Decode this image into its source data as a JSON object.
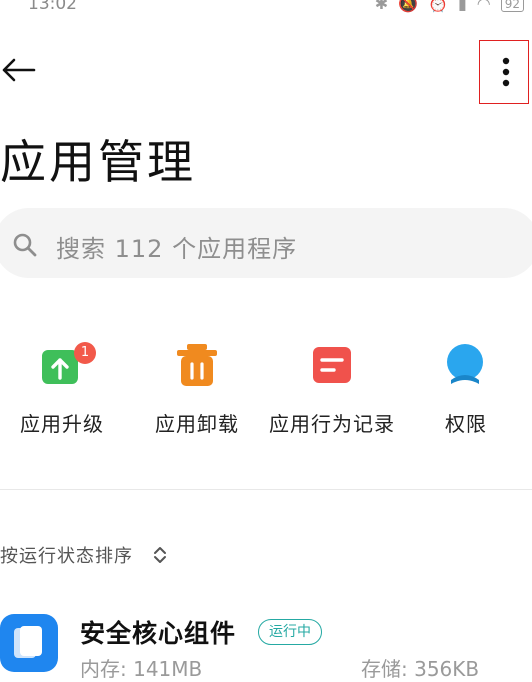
{
  "status_bar": {
    "time": "13:02",
    "battery": "92",
    "icons": [
      "bluetooth-icon",
      "mute-icon",
      "alarm-icon",
      "signal-icon",
      "wifi-icon",
      "battery-icon"
    ]
  },
  "header": {
    "back_icon": "arrow-left-icon",
    "more_icon": "more-vertical-icon",
    "title": "应用管理"
  },
  "search": {
    "placeholder": "搜索 112 个应用程序"
  },
  "actions": [
    {
      "label": "应用升级",
      "icon": "upgrade-icon",
      "color": "#3fbf5a",
      "badge": "1"
    },
    {
      "label": "应用卸载",
      "icon": "trash-icon",
      "color": "#f08a1f"
    },
    {
      "label": "应用行为记录",
      "icon": "record-icon",
      "color": "#f0524c"
    },
    {
      "label": "权限",
      "icon": "permission-icon",
      "color": "#2aa6ee"
    }
  ],
  "sort": {
    "label": "按运行状态排序",
    "icon": "sort-toggle-icon"
  },
  "apps": [
    {
      "name": "安全核心组件",
      "status": "运行中",
      "memory": "内存: 141MB",
      "storage": "存储: 356KB",
      "icon_color": "#1f86ef"
    }
  ],
  "colors": {
    "accent_teal": "#25a9a3",
    "badge_red": "#f2594a",
    "highlight_border": "#e02020"
  }
}
